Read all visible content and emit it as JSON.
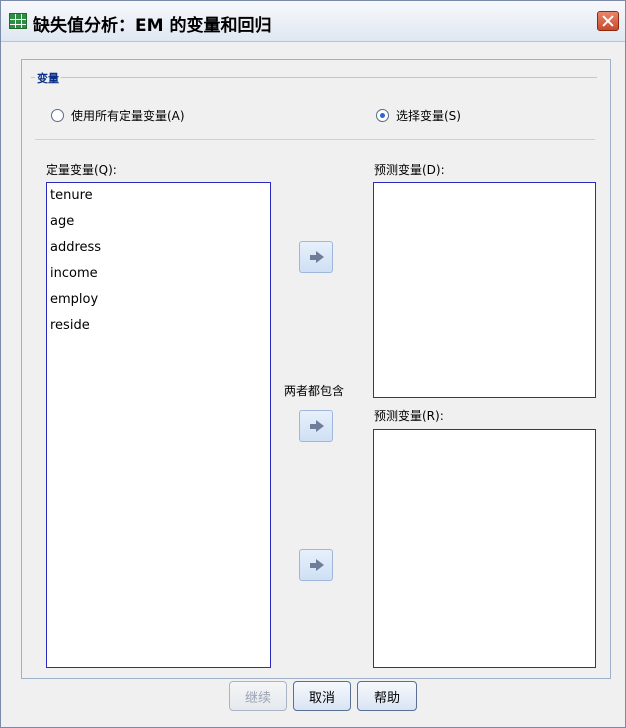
{
  "window": {
    "title": "缺失值分析：EM 的变量和回归",
    "app_icon": "spreadsheet-grid-icon",
    "close_icon": "close-icon"
  },
  "variables_group": {
    "label": "变量",
    "radio_all": {
      "label": "使用所有定量变量(A)",
      "selected": false
    },
    "radio_select": {
      "label": "选择变量(S)",
      "selected": true
    }
  },
  "quantitative_list": {
    "label": "定量变量(Q):",
    "items": [
      "tenure",
      "age",
      "address",
      "income",
      "employ",
      "reside"
    ]
  },
  "predicted_list": {
    "label": "预测变量(D):",
    "items": []
  },
  "both_label": "两者都包含",
  "predictor_list": {
    "label": "预测变量(R):",
    "items": []
  },
  "arrow_icon": "right-arrow-icon",
  "footer": {
    "continue_label": "继续",
    "cancel_label": "取消",
    "help_label": "帮助"
  },
  "colors": {
    "list_border": "#2d2bbf",
    "group_label": "#0b2f8a"
  }
}
